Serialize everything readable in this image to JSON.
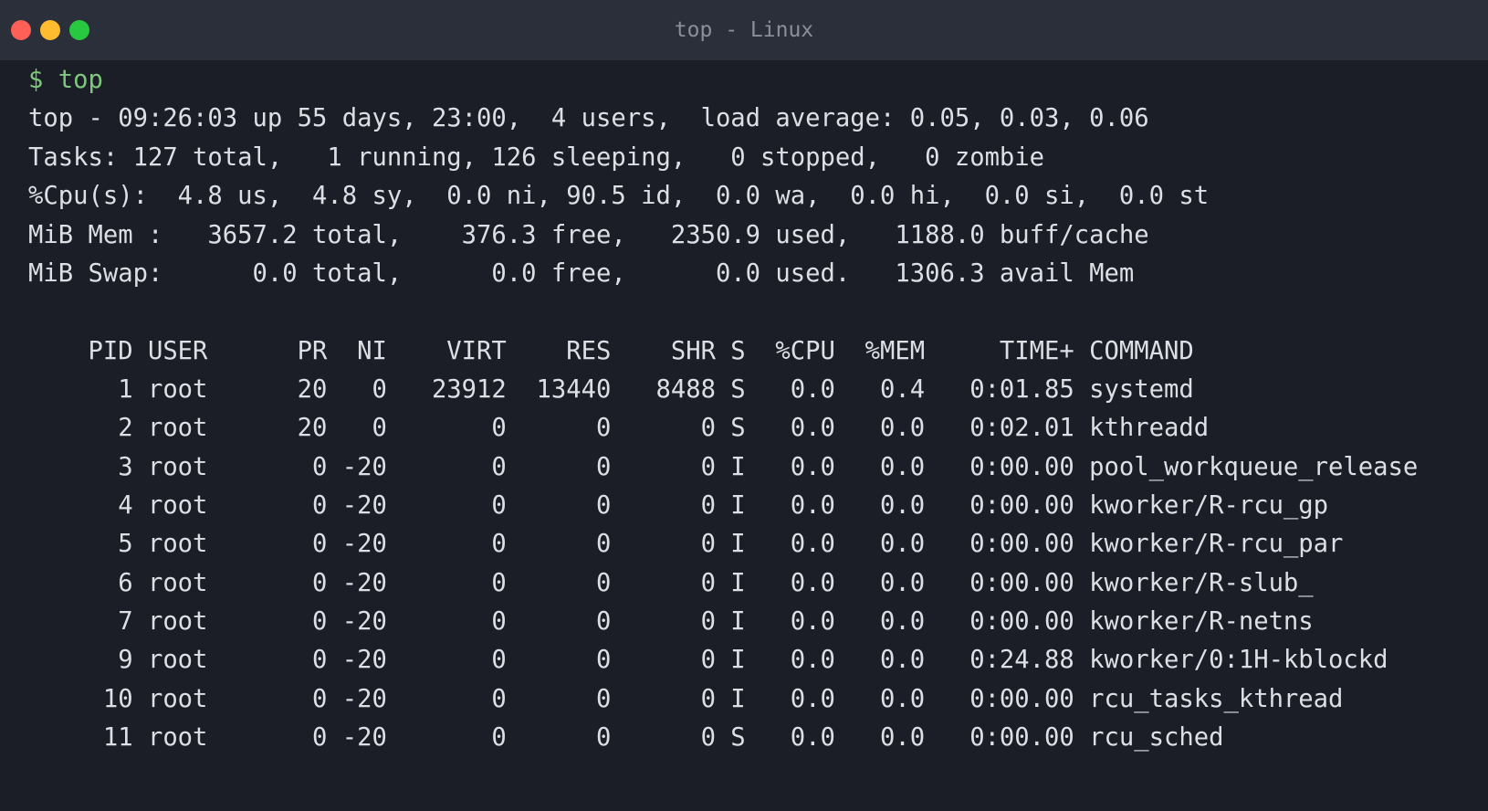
{
  "window": {
    "title": "top - Linux",
    "colors": {
      "background": "#1b1e26",
      "titlebar": "#2b2f3a",
      "text": "#dcdfe4",
      "prompt": "#7ec87e",
      "close": "#fe5f57",
      "minimize": "#febc2e",
      "maximize": "#28c840"
    }
  },
  "prompt": "$ top",
  "summary": {
    "uptime_line": "top - 09:26:03 up 55 days, 23:00,  4 users,  load average: 0.05, 0.03, 0.06",
    "tasks_line": "Tasks: 127 total,   1 running, 126 sleeping,   0 stopped,   0 zombie",
    "cpu_line": "%Cpu(s):  4.8 us,  4.8 sy,  0.0 ni, 90.5 id,  0.0 wa,  0.0 hi,  0.0 si,  0.0 st",
    "mem_line": "MiB Mem :   3657.2 total,    376.3 free,   2350.9 used,   1188.0 buff/cache",
    "swap_line": "MiB Swap:      0.0 total,      0.0 free,      0.0 used.   1306.3 avail Mem"
  },
  "table": {
    "header": "    PID USER      PR  NI    VIRT    RES    SHR S  %CPU  %MEM     TIME+ COMMAND",
    "rows": [
      "      1 root      20   0   23912  13440   8488 S   0.0   0.4   0:01.85 systemd",
      "      2 root      20   0       0      0      0 S   0.0   0.0   0:02.01 kthreadd",
      "      3 root       0 -20       0      0      0 I   0.0   0.0   0:00.00 pool_workqueue_release",
      "      4 root       0 -20       0      0      0 I   0.0   0.0   0:00.00 kworker/R-rcu_gp",
      "      5 root       0 -20       0      0      0 I   0.0   0.0   0:00.00 kworker/R-rcu_par",
      "      6 root       0 -20       0      0      0 I   0.0   0.0   0:00.00 kworker/R-slub_",
      "      7 root       0 -20       0      0      0 I   0.0   0.0   0:00.00 kworker/R-netns",
      "      9 root       0 -20       0      0      0 I   0.0   0.0   0:24.88 kworker/0:1H-kblockd",
      "     10 root       0 -20       0      0      0 I   0.0   0.0   0:00.00 rcu_tasks_kthread",
      "     11 root       0 -20       0      0      0 S   0.0   0.0   0:00.00 rcu_sched"
    ]
  }
}
